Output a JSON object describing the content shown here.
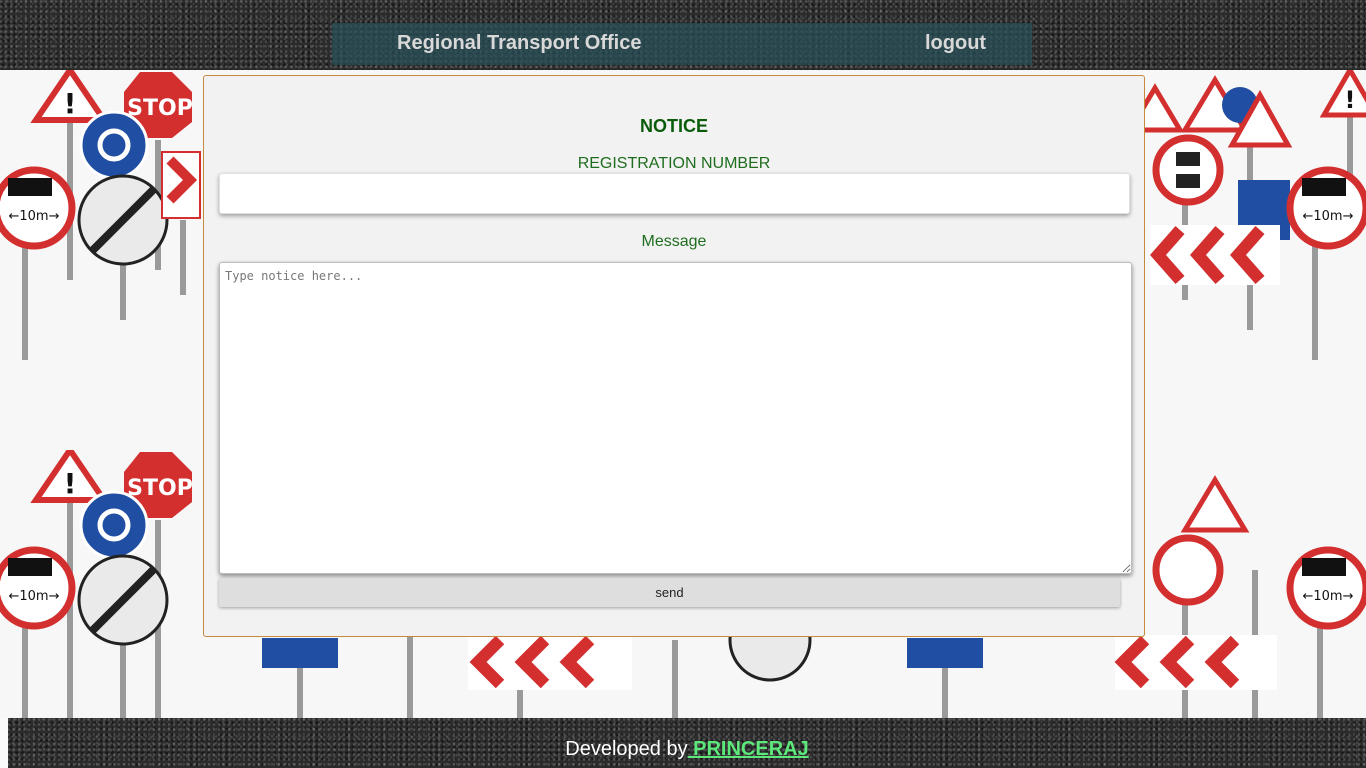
{
  "header": {
    "title": "Regional Transport Office",
    "logout_label": "logout"
  },
  "form": {
    "title": "NOTICE",
    "registration_label": "REGISTRATION NUMBER",
    "registration_value": "",
    "message_label": "Message",
    "message_placeholder": "Type notice here...",
    "message_value": "",
    "send_label": "send"
  },
  "footer": {
    "prefix": "Developed by",
    "author": " PRINCERAJ"
  },
  "colors": {
    "nav_background": "#28505a",
    "heading_green": "#0a5c0a",
    "label_green": "#1f6e1f",
    "author_link": "#5ce87a",
    "card_border": "#c58a3c"
  },
  "icons": [
    "warning-sign-icon",
    "stop-sign-icon",
    "roundabout-sign-icon",
    "no-trucks-sign-icon",
    "end-of-restriction-sign-icon",
    "chevron-sign-icon",
    "no-overtaking-sign-icon",
    "children-crossing-sign-icon"
  ]
}
